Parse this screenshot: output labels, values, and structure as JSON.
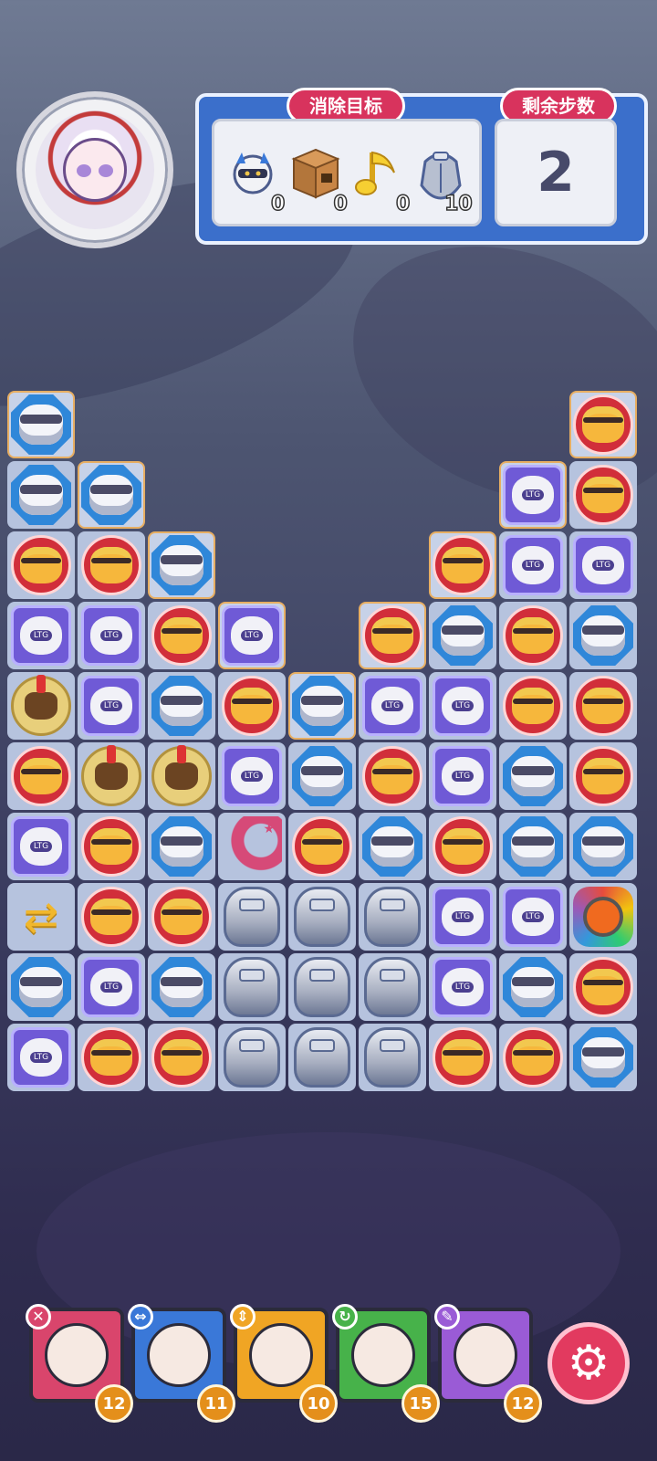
{
  "header": {
    "goal_tag": "消除目标",
    "moves_tag": "剩余步数",
    "moves_remaining": "2",
    "goals": [
      {
        "icon": "robot-helmet-icon",
        "count": "0"
      },
      {
        "icon": "cardboard-box-icon",
        "count": "0"
      },
      {
        "icon": "music-note-icon",
        "count": "0"
      },
      {
        "icon": "stone-armor-icon",
        "count": "10"
      }
    ]
  },
  "board": {
    "cols": 9,
    "rows": 10,
    "grid": [
      [
        "blue",
        "none",
        "none",
        "none",
        "none",
        "none",
        "none",
        "none",
        "red"
      ],
      [
        "blue",
        "blue",
        "none",
        "none",
        "none",
        "none",
        "none",
        "purple",
        "red"
      ],
      [
        "red",
        "red",
        "blue",
        "none",
        "none",
        "none",
        "red",
        "purple",
        "purple"
      ],
      [
        "purple",
        "purple",
        "red",
        "purple",
        "none",
        "red",
        "blue",
        "red",
        "blue"
      ],
      [
        "helmet",
        "purple",
        "blue",
        "red",
        "blue",
        "purple",
        "purple",
        "red",
        "red"
      ],
      [
        "red",
        "helmet",
        "helmet",
        "purple",
        "blue",
        "red",
        "purple",
        "blue",
        "red"
      ],
      [
        "purple",
        "red",
        "blue",
        "moon",
        "red",
        "blue",
        "red",
        "blue",
        "blue"
      ],
      [
        "arrows",
        "red",
        "red",
        "stone",
        "stone",
        "stone",
        "purple",
        "purple",
        "rainbow"
      ],
      [
        "blue",
        "purple",
        "blue",
        "stone",
        "stone",
        "stone",
        "purple",
        "blue",
        "red"
      ],
      [
        "purple",
        "red",
        "red",
        "stone",
        "stone",
        "stone",
        "red",
        "red",
        "blue"
      ]
    ]
  },
  "heroes": [
    {
      "name": "hero-star-hat",
      "bg": "#d9456c",
      "skill_color": "#d9456c",
      "skill_icon": "✕",
      "energy": "12"
    },
    {
      "name": "hero-visor",
      "bg": "#3a78d8",
      "skill_color": "#3a78d8",
      "skill_icon": "⇔",
      "energy": "11"
    },
    {
      "name": "hero-white-hair",
      "bg": "#f0a524",
      "skill_color": "#f0a524",
      "skill_icon": "⇕",
      "energy": "10"
    },
    {
      "name": "hero-brown-hair",
      "bg": "#47b24a",
      "skill_color": "#47b24a",
      "skill_icon": "↻",
      "energy": "15"
    },
    {
      "name": "hero-blonde",
      "bg": "#9a5bd6",
      "skill_color": "#9a5bd6",
      "skill_icon": "✎",
      "energy": "12"
    }
  ],
  "settings_icon": "gear-icon",
  "colors": {
    "panel_blue": "#3b6fcb",
    "tag_red": "#d8335d",
    "board_border": "#e7ae62"
  }
}
